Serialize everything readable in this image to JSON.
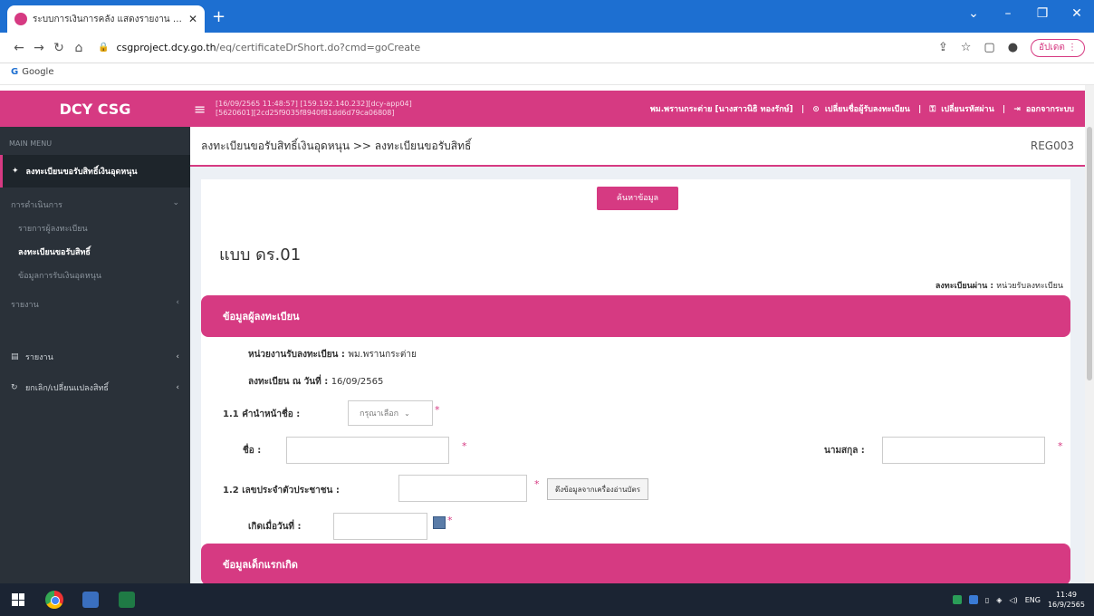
{
  "browser": {
    "tab_title": "ระบบการเงินการคลัง แสดงรายงาน (ดร.)",
    "url_host": "csgproject.dcy.go.th",
    "url_path": "/eq/certificateDrShort.do?cmd=goCreate",
    "update_label": "อัปเดต",
    "bookmark_label": "Google"
  },
  "header": {
    "brand": "DCY CSG",
    "session_line1": "[16/09/2565 11:48:57] [159.192.140.232][dcy-app04]",
    "session_line2": "[5620601][2cd25f9035f8940f81dd6d79ca06808]",
    "user": "พม.พรานกระต่าย [นางสาวนิธิ ทองรักษ์]",
    "change_registrar": "เปลี่ยนชื่อผู้รับลงทะเบียน",
    "change_password": "เปลี่ยนรหัสผ่าน",
    "logout": "ออกจากระบบ"
  },
  "sidebar": {
    "main_menu": "MAIN MENU",
    "active": "ลงทะเบียนขอรับสิทธิ์เงินอุดหนุน",
    "section_ops": "การดำเนินการ",
    "sub_items": [
      "รายการผู้ลงทะเบียน",
      "ลงทะเบียนขอรับสิทธิ์",
      "ข้อมูลการรับเงินอุดหนุน"
    ],
    "section_report": "รายงาน",
    "items": [
      "รายงาน",
      "ยกเลิก/เปลี่ยนแปลงสิทธิ์"
    ]
  },
  "page": {
    "breadcrumb": "ลงทะเบียนขอรับสิทธิ์เงินอุดหนุน >> ลงทะเบียนขอรับสิทธิ์",
    "code": "REG003",
    "search_btn": "ค้นหาข้อมูล",
    "form_title": "แบบ ดร.01",
    "reg_via_label": "ลงทะเบียนผ่าน :",
    "reg_via_value": "หน่วยรับลงทะเบียน",
    "section1": "ข้อมูลผู้ลงทะเบียน",
    "unit_label": "หน่วยงานรับลงทะเบียน :",
    "unit_value": "พม.พรานกระต่าย",
    "date_label": "ลงทะเบียน ณ วันที่ :",
    "date_value": "16/09/2565",
    "prefix_label": "1.1 คำนำหน้าชื่อ :",
    "prefix_select": "กรุณาเลือก",
    "name_label": "ชื่อ :",
    "surname_label": "นามสกุล :",
    "id_label": "1.2 เลขประจำตัวประชาชน :",
    "read_card_btn": "ดึงข้อมูลจากเครื่องอ่านบัตร",
    "birth_label": "เกิดเมื่อวันที่ :",
    "section2": "ข้อมูลเด็กแรกเกิด"
  },
  "taskbar": {
    "lang": "ENG",
    "time": "11:49",
    "date": "16/9/2565"
  }
}
